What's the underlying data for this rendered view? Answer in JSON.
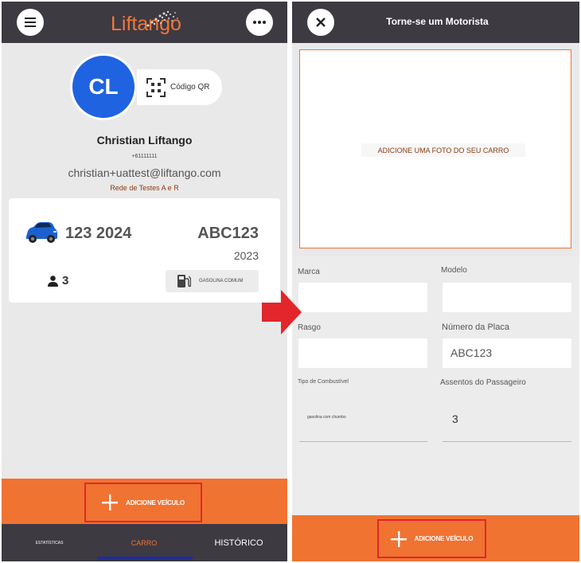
{
  "left": {
    "header": {
      "menu_icon": "hamburger-menu-icon",
      "logo_text": "Liftango",
      "more_icon": "ellipsis-icon"
    },
    "profile": {
      "initials": "CL",
      "qr_label": "Código QR",
      "name": "Christian Liftango",
      "phone": "+61111111",
      "email": "christian+uattest@liftango.com",
      "network": "Rede de Testes A e R"
    },
    "vehicle": {
      "model": "123 2024",
      "plate": "ABC123",
      "year": "2023",
      "seats": "3",
      "fuel": "GASOLINA COMUM"
    },
    "add_vehicle_label": "ADICIONE VEÍCULO",
    "nav": {
      "stats": "ESTATÍSTICAS",
      "car": "CARRO",
      "history": "HISTÓRICO"
    }
  },
  "right": {
    "title": "Torne-se um Motorista",
    "photo_label": "ADICIONE UMA FOTO DO SEU CARRO",
    "fields": {
      "brand_label": "Marca",
      "model_label": "Modelo",
      "trim_label": "Rasgo",
      "plate_label": "Número da Placa",
      "plate_value": "ABC123",
      "fuel_label": "Tipo de Combustível",
      "fuel_value": "gasolina com chumbo",
      "seats_label": "Assentos do Passageiro",
      "seats_value": "3"
    },
    "add_vehicle_label": "ADICIONE VEÍCULO"
  },
  "colors": {
    "header": "#3d3a42",
    "accent_orange": "#f07332",
    "avatar_blue": "#1f63e0",
    "highlight_red": "#e2262b",
    "nav_underline": "#1f2a9c"
  }
}
